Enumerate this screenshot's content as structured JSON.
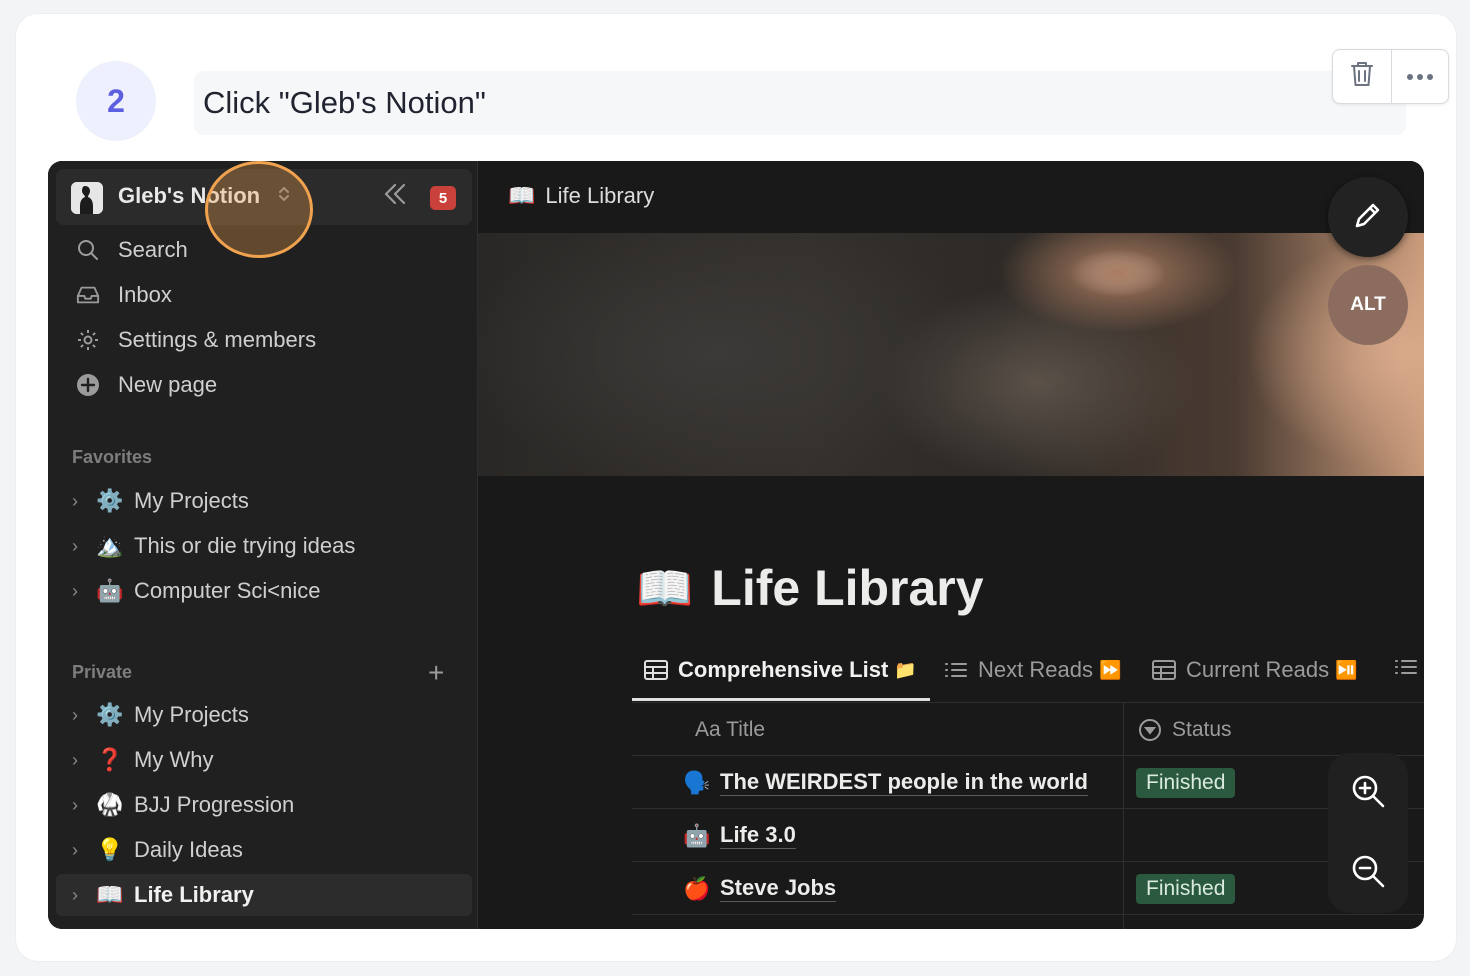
{
  "step": {
    "number": "2",
    "instruction": "Click \"Gleb's Notion\""
  },
  "actions": {
    "delete_icon": "trash-icon",
    "more_icon": "more-horizontal-icon"
  },
  "sidebar": {
    "workspace_name": "Gleb's Notion",
    "notification_count": "5",
    "nav": [
      {
        "label": "Search",
        "icon": "search-icon"
      },
      {
        "label": "Inbox",
        "icon": "inbox-icon"
      },
      {
        "label": "Settings & members",
        "icon": "gear-icon"
      },
      {
        "label": "New page",
        "icon": "plus-circle-icon"
      }
    ],
    "favorites_label": "Favorites",
    "favorites": [
      {
        "label": "My Projects",
        "emoji": "⚙️"
      },
      {
        "label": "This or die trying ideas",
        "emoji": "🏔️"
      },
      {
        "label": "Computer Sci<nice",
        "emoji": "🤖"
      }
    ],
    "private_label": "Private",
    "private": [
      {
        "label": "My Projects",
        "emoji": "⚙️"
      },
      {
        "label": "My Why",
        "emoji": "❓"
      },
      {
        "label": "BJJ Progression",
        "emoji": "🥋"
      },
      {
        "label": "Daily Ideas",
        "emoji": "💡"
      },
      {
        "label": "Life Library",
        "emoji": "📖"
      }
    ]
  },
  "main": {
    "breadcrumb": "Life Library",
    "breadcrumb_emoji": "📖",
    "page_emoji": "📖",
    "page_title": "Life Library",
    "alt_label": "ALT",
    "tabs": [
      {
        "label": "Comprehensive List",
        "suffix": "📁"
      },
      {
        "label": "Next Reads",
        "suffix": "⏩"
      },
      {
        "label": "Current Reads",
        "suffix": "⏯️"
      }
    ],
    "table": {
      "col_title": "Aa Title",
      "col_status": "Status",
      "rows": [
        {
          "emoji": "🗣️",
          "title": "The WEIRDEST people in the world",
          "status": "Finished"
        },
        {
          "emoji": "🤖",
          "title": "Life 3.0",
          "status": ""
        },
        {
          "emoji": "🍎",
          "title": "Steve Jobs",
          "status": "Finished"
        }
      ]
    }
  },
  "colors": {
    "accent": "#5b5fe0",
    "highlight_ring": "#f0a24f",
    "badge_red": "#c9413a",
    "status_green": "#2b593f"
  }
}
